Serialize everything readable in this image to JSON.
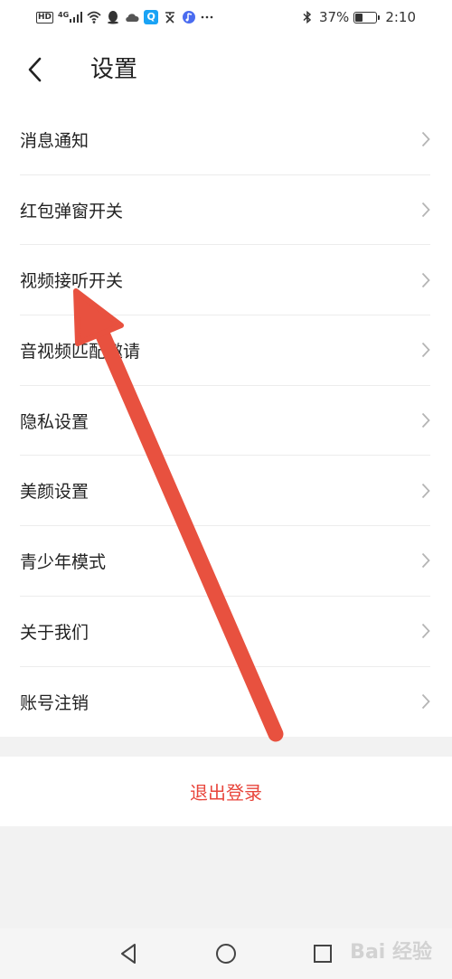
{
  "statusbar": {
    "left_badges": [
      "HD",
      "4G"
    ],
    "battery_percent": "37%",
    "battery_level": 0.37,
    "time": "2:10"
  },
  "header": {
    "title": "设置"
  },
  "menu": {
    "items": [
      {
        "label": "消息通知"
      },
      {
        "label": "红包弹窗开关"
      },
      {
        "label": "视频接听开关"
      },
      {
        "label": "音视频匹配邀请"
      },
      {
        "label": "隐私设置"
      },
      {
        "label": "美颜设置"
      },
      {
        "label": "青少年模式"
      },
      {
        "label": "关于我们"
      },
      {
        "label": "账号注销"
      }
    ]
  },
  "logout": {
    "label": "退出登录"
  },
  "watermark": {
    "text": "Bai 经验"
  },
  "colors": {
    "accent_red": "#e8463c",
    "annotation_arrow": "#e8513f",
    "divider": "#ececec",
    "background": "#f2f2f2"
  },
  "icons": [
    "hd-icon",
    "signal-icon",
    "wifi-icon",
    "qq-icon",
    "cloud-icon",
    "search-app-icon",
    "text-app-icon",
    "music-app-icon",
    "more-icon",
    "bluetooth-icon",
    "battery-icon",
    "back-arrow-icon",
    "chevron-right-icon",
    "nav-back-icon",
    "nav-home-icon",
    "nav-recents-icon"
  ]
}
